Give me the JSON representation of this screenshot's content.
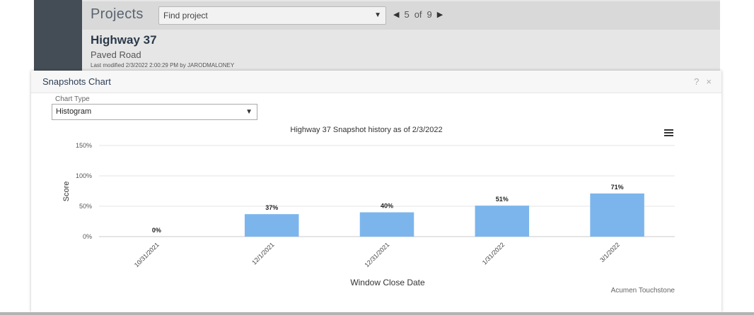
{
  "header": {
    "title": "Projects",
    "search_placeholder": "Find project",
    "pager": {
      "current": "5",
      "of_label": "of",
      "total": "9"
    }
  },
  "project": {
    "name": "Highway 37",
    "type": "Paved Road",
    "modified": "Last modified 2/3/2022 2:00:29 PM by JARODMALONEY"
  },
  "panel": {
    "title": "Snapshots Chart",
    "help_glyph": "?",
    "close_glyph": "×",
    "chart_type_label": "Chart Type",
    "chart_type_value": "Histogram"
  },
  "icons": {
    "pager_prev": "triangle-left-icon",
    "pager_next": "triangle-right-icon",
    "dropdown": "caret-down-icon",
    "chart_menu": "hamburger-menu-icon"
  },
  "colors": {
    "bar": "#7cb5ec"
  },
  "chart_data": {
    "type": "bar",
    "title": "Highway 37 Snapshot history as of 2/3/2022",
    "xlabel": "Window Close Date",
    "ylabel": "Score",
    "categories": [
      "10/31/2021",
      "12/1/2021",
      "12/31/2021",
      "1/31/2022",
      "3/1/2022"
    ],
    "values": [
      0,
      37,
      40,
      51,
      71
    ],
    "data_labels": [
      "0%",
      "37%",
      "40%",
      "51%",
      "71%"
    ],
    "ylim": [
      0,
      150
    ],
    "yticks": [
      0,
      50,
      100,
      150
    ],
    "ytick_labels": [
      "0%",
      "50%",
      "100%",
      "150%"
    ],
    "grid": true,
    "credit": "Acumen Touchstone"
  }
}
